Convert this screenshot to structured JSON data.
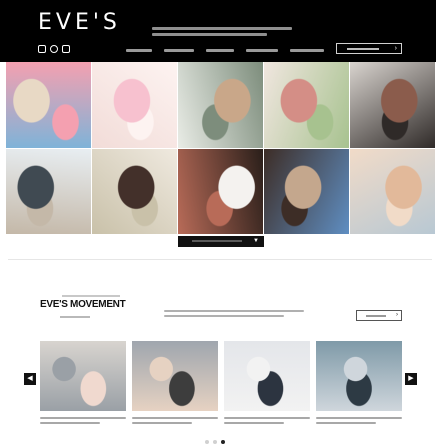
{
  "header": {
    "eyebrow": "",
    "logo": "EVE'S",
    "social": [
      {
        "icon": "instagram-icon"
      },
      {
        "icon": "pinterest-icon"
      },
      {
        "icon": "facebook-icon"
      }
    ],
    "nav_count": 5
  },
  "gallery": {
    "tiles": [
      {
        "icon": "photo-icon",
        "label": "",
        "colors": [
          "#7fb3d8",
          "#e8d9c5",
          "#f4a0b0"
        ]
      },
      {
        "icon": "photo-icon",
        "label": "",
        "colors": [
          "#f2dcd8",
          "#f7c1cf",
          "#fdf3f1"
        ]
      },
      {
        "icon": "photo-icon",
        "label": "",
        "colors": [
          "#e9ece6",
          "#c9a789",
          "#7d8d7c"
        ]
      },
      {
        "icon": "photo-icon",
        "label": "",
        "colors": [
          "#f0e6df",
          "#d48e86",
          "#a7c28f"
        ]
      },
      {
        "icon": "photo-icon",
        "label": "",
        "colors": [
          "#d9d4cf",
          "#8b5c4c",
          "#2f2a28"
        ]
      },
      {
        "icon": "photo-icon",
        "label": "",
        "colors": [
          "#e8eef2",
          "#404a52",
          "#c4b8a8"
        ]
      },
      {
        "icon": "photo-icon",
        "label": "",
        "colors": [
          "#efe9df",
          "#43302a",
          "#c9c1a9"
        ]
      },
      {
        "icon": "photo-icon",
        "label": "",
        "colors": [
          "#2a1f1a",
          "#f4f2ef",
          "#b86b58"
        ]
      },
      {
        "icon": "photo-icon",
        "label": "",
        "colors": [
          "#5f8ec2",
          "#c4a78d",
          "#3d2d26"
        ]
      },
      {
        "icon": "photo-icon",
        "label": "",
        "colors": [
          "#b8c8d3",
          "#e2b99a",
          "#f1dbc8"
        ]
      }
    ]
  },
  "movement": {
    "title": "EVE'S MOVEMENT",
    "cards": [
      {
        "label": "",
        "colors": [
          "#d8d4cf",
          "#f0d9cf",
          "#9aa0a6"
        ]
      },
      {
        "label": "",
        "colors": [
          "#9fa6ae",
          "#3d3d3d",
          "#e6d2c2"
        ]
      },
      {
        "label": "",
        "colors": [
          "#e4e6ea",
          "#2c3440",
          "#f2f2f2"
        ]
      },
      {
        "label": "",
        "colors": [
          "#7f9aa8",
          "#2d3a44",
          "#cfd6dc"
        ]
      }
    ],
    "dots": [
      false,
      false,
      true
    ]
  },
  "colors": {
    "header_bg": "#000000",
    "accent_dark": "#111111"
  }
}
